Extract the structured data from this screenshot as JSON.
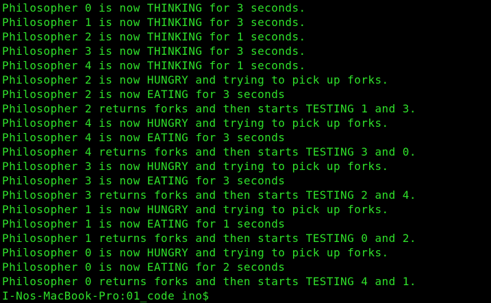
{
  "terminal": {
    "text_color": "#2fe12a",
    "background": "#000000",
    "lines": [
      "Philosopher 0 is now THINKING for 3 seconds.",
      "Philosopher 1 is now THINKING for 3 seconds.",
      "Philosopher 2 is now THINKING for 1 seconds.",
      "Philosopher 3 is now THINKING for 3 seconds.",
      "Philosopher 4 is now THINKING for 1 seconds.",
      "Philosopher 2 is now HUNGRY and trying to pick up forks.",
      "Philosopher 2 is now EATING for 3 seconds",
      "Philosopher 2 returns forks and then starts TESTING 1 and 3.",
      "Philosopher 4 is now HUNGRY and trying to pick up forks.",
      "Philosopher 4 is now EATING for 3 seconds",
      "Philosopher 4 returns forks and then starts TESTING 3 and 0.",
      "Philosopher 3 is now HUNGRY and trying to pick up forks.",
      "Philosopher 3 is now EATING for 3 seconds",
      "Philosopher 3 returns forks and then starts TESTING 2 and 4.",
      "Philosopher 1 is now HUNGRY and trying to pick up forks.",
      "Philosopher 1 is now EATING for 1 seconds",
      "Philosopher 1 returns forks and then starts TESTING 0 and 2.",
      "Philosopher 0 is now HUNGRY and trying to pick up forks.",
      "Philosopher 0 is now EATING for 2 seconds",
      "Philosopher 0 returns forks and then starts TESTING 4 and 1."
    ],
    "prompt": "I-Nos-MacBook-Pro:01_code ino$ "
  }
}
